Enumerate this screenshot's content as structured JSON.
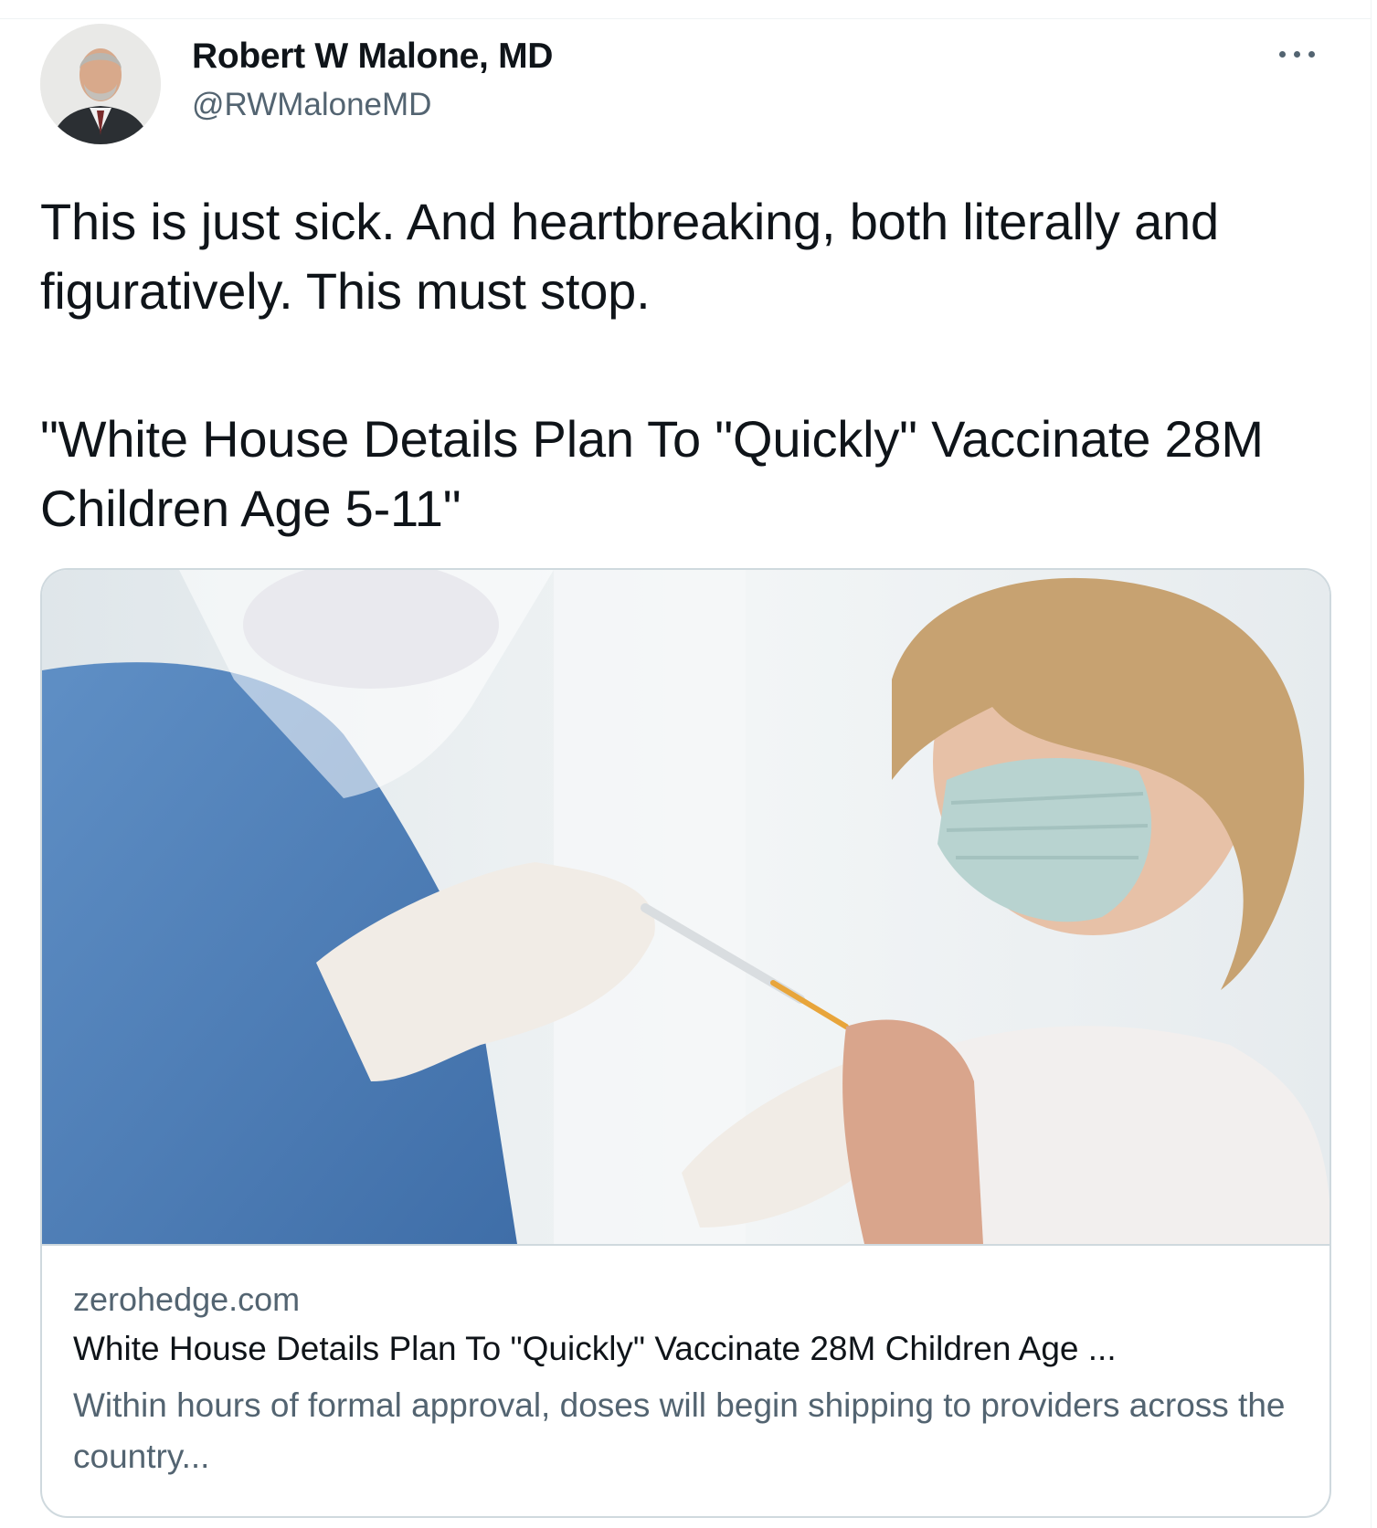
{
  "author": {
    "name": "Robert W Malone, MD",
    "handle": "@RWMaloneMD"
  },
  "tweet": {
    "text_line1": "This is just sick.  And heartbreaking, both literally and figuratively. This must stop.",
    "text_line2": "\"White House Details Plan To \"Quickly\" Vaccinate 28M Children Age 5-11\""
  },
  "card": {
    "domain": "zerohedge.com",
    "title": "White House Details Plan To \"Quickly\" Vaccinate 28M Children Age ...",
    "description": "Within hours of formal approval, doses will begin shipping to providers across the country..."
  },
  "icons": {
    "more": "more-options-icon"
  },
  "colors": {
    "secondary_text": "#536471",
    "border": "#cfd9de",
    "primary_text": "#0f1419"
  }
}
